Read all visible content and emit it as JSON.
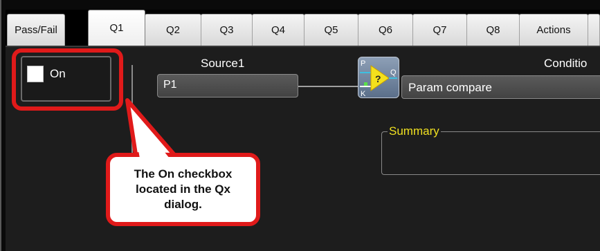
{
  "tabs": [
    {
      "label": "Pass/Fail"
    },
    {
      "label": "Q1"
    },
    {
      "label": "Q2"
    },
    {
      "label": "Q3"
    },
    {
      "label": "Q4"
    },
    {
      "label": "Q5"
    },
    {
      "label": "Q6"
    },
    {
      "label": "Q7"
    },
    {
      "label": "Q8"
    },
    {
      "label": "Actions"
    }
  ],
  "active_tab": "Q1",
  "on_checkbox": {
    "label": "On",
    "checked": false
  },
  "source1": {
    "label": "Source1",
    "value": "P1"
  },
  "block_icon": {
    "name": "param-compare-block-icon",
    "inputs": [
      "P",
      "K"
    ],
    "output": "Q",
    "symbol": "?"
  },
  "condition": {
    "label": "Conditio",
    "value": "Param compare"
  },
  "summary": {
    "label": "Summary",
    "value": ""
  },
  "callout": {
    "text": "The On checkbox\nlocated in the Qx\ndialog."
  },
  "colors": {
    "highlight": "#e01a1a",
    "summary_label": "#f0e020",
    "background": "#1d1d1d"
  }
}
